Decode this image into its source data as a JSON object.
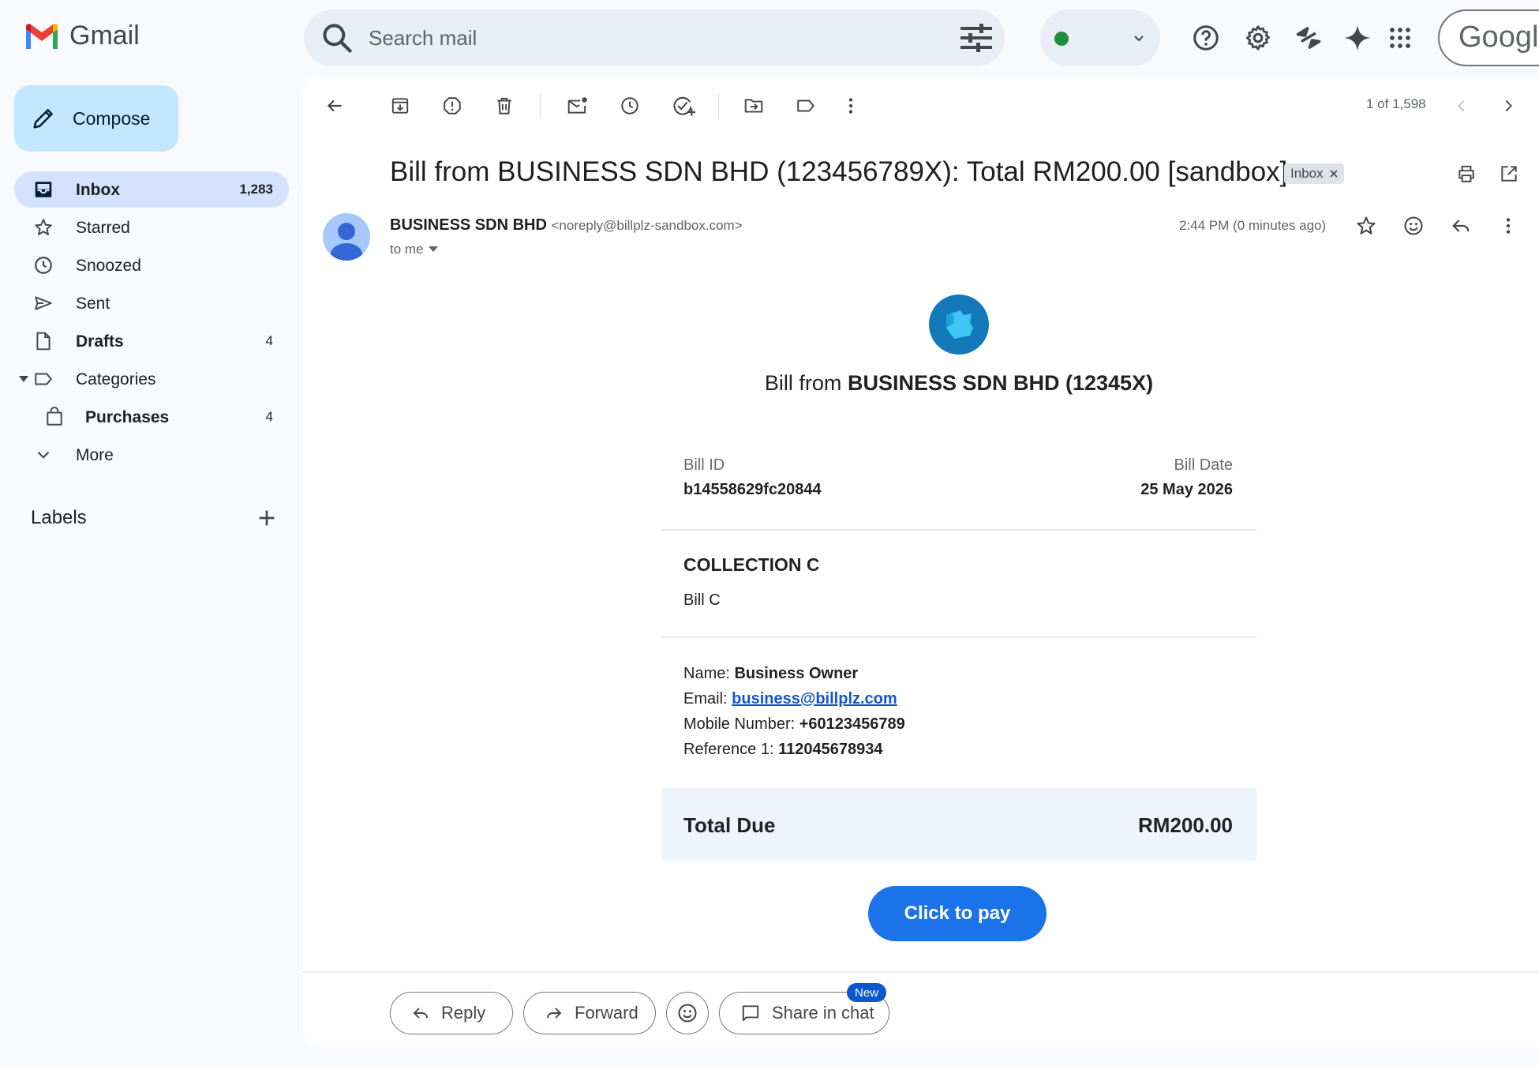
{
  "app": {
    "name": "Gmail"
  },
  "search": {
    "placeholder": "Search mail"
  },
  "account": {
    "logo_text": "Google"
  },
  "sidebar": {
    "compose": "Compose",
    "items": [
      {
        "label": "Inbox",
        "count": "1,283"
      },
      {
        "label": "Starred",
        "count": ""
      },
      {
        "label": "Snoozed",
        "count": ""
      },
      {
        "label": "Sent",
        "count": ""
      },
      {
        "label": "Drafts",
        "count": "4"
      },
      {
        "label": "Categories",
        "count": ""
      },
      {
        "label": "Purchases",
        "count": "4"
      },
      {
        "label": "More",
        "count": ""
      }
    ],
    "labels_title": "Labels"
  },
  "toolbar": {
    "pager": "1 of 1,598"
  },
  "email": {
    "subject": "Bill from BUSINESS SDN BHD (123456789X): Total RM200.00 [sandbox]",
    "chip": "Inbox",
    "sender_name": "BUSINESS SDN BHD",
    "sender_email": "<noreply@billplz-sandbox.com>",
    "to": "to me",
    "time": "2:44 PM (0 minutes ago)"
  },
  "bill": {
    "heading_prefix": "Bill from",
    "heading_business": "BUSINESS SDN BHD (12345X)",
    "bill_id_label": "Bill ID",
    "bill_id": "b14558629fc20844",
    "bill_date_label": "Bill Date",
    "bill_date": "25 May 2026",
    "collection": "COLLECTION C",
    "bill_name": "Bill C",
    "name_label": "Name:",
    "name": "Business Owner",
    "email_label": "Email:",
    "email": "business@billplz.com",
    "mobile_label": "Mobile Number:",
    "mobile": "+60123456789",
    "ref_label": "Reference 1:",
    "ref": "112045678934",
    "total_label": "Total Due",
    "total": "RM200.00",
    "pay_button": "Click to pay"
  },
  "actions": {
    "reply": "Reply",
    "forward": "Forward",
    "share": "Share in chat",
    "new_badge": "New"
  },
  "colors": {
    "accent": "#1a73e8",
    "compose_bg": "#c2e7ff",
    "active_nav": "#d3e3fd",
    "status_dot": "#1e8e3e"
  }
}
